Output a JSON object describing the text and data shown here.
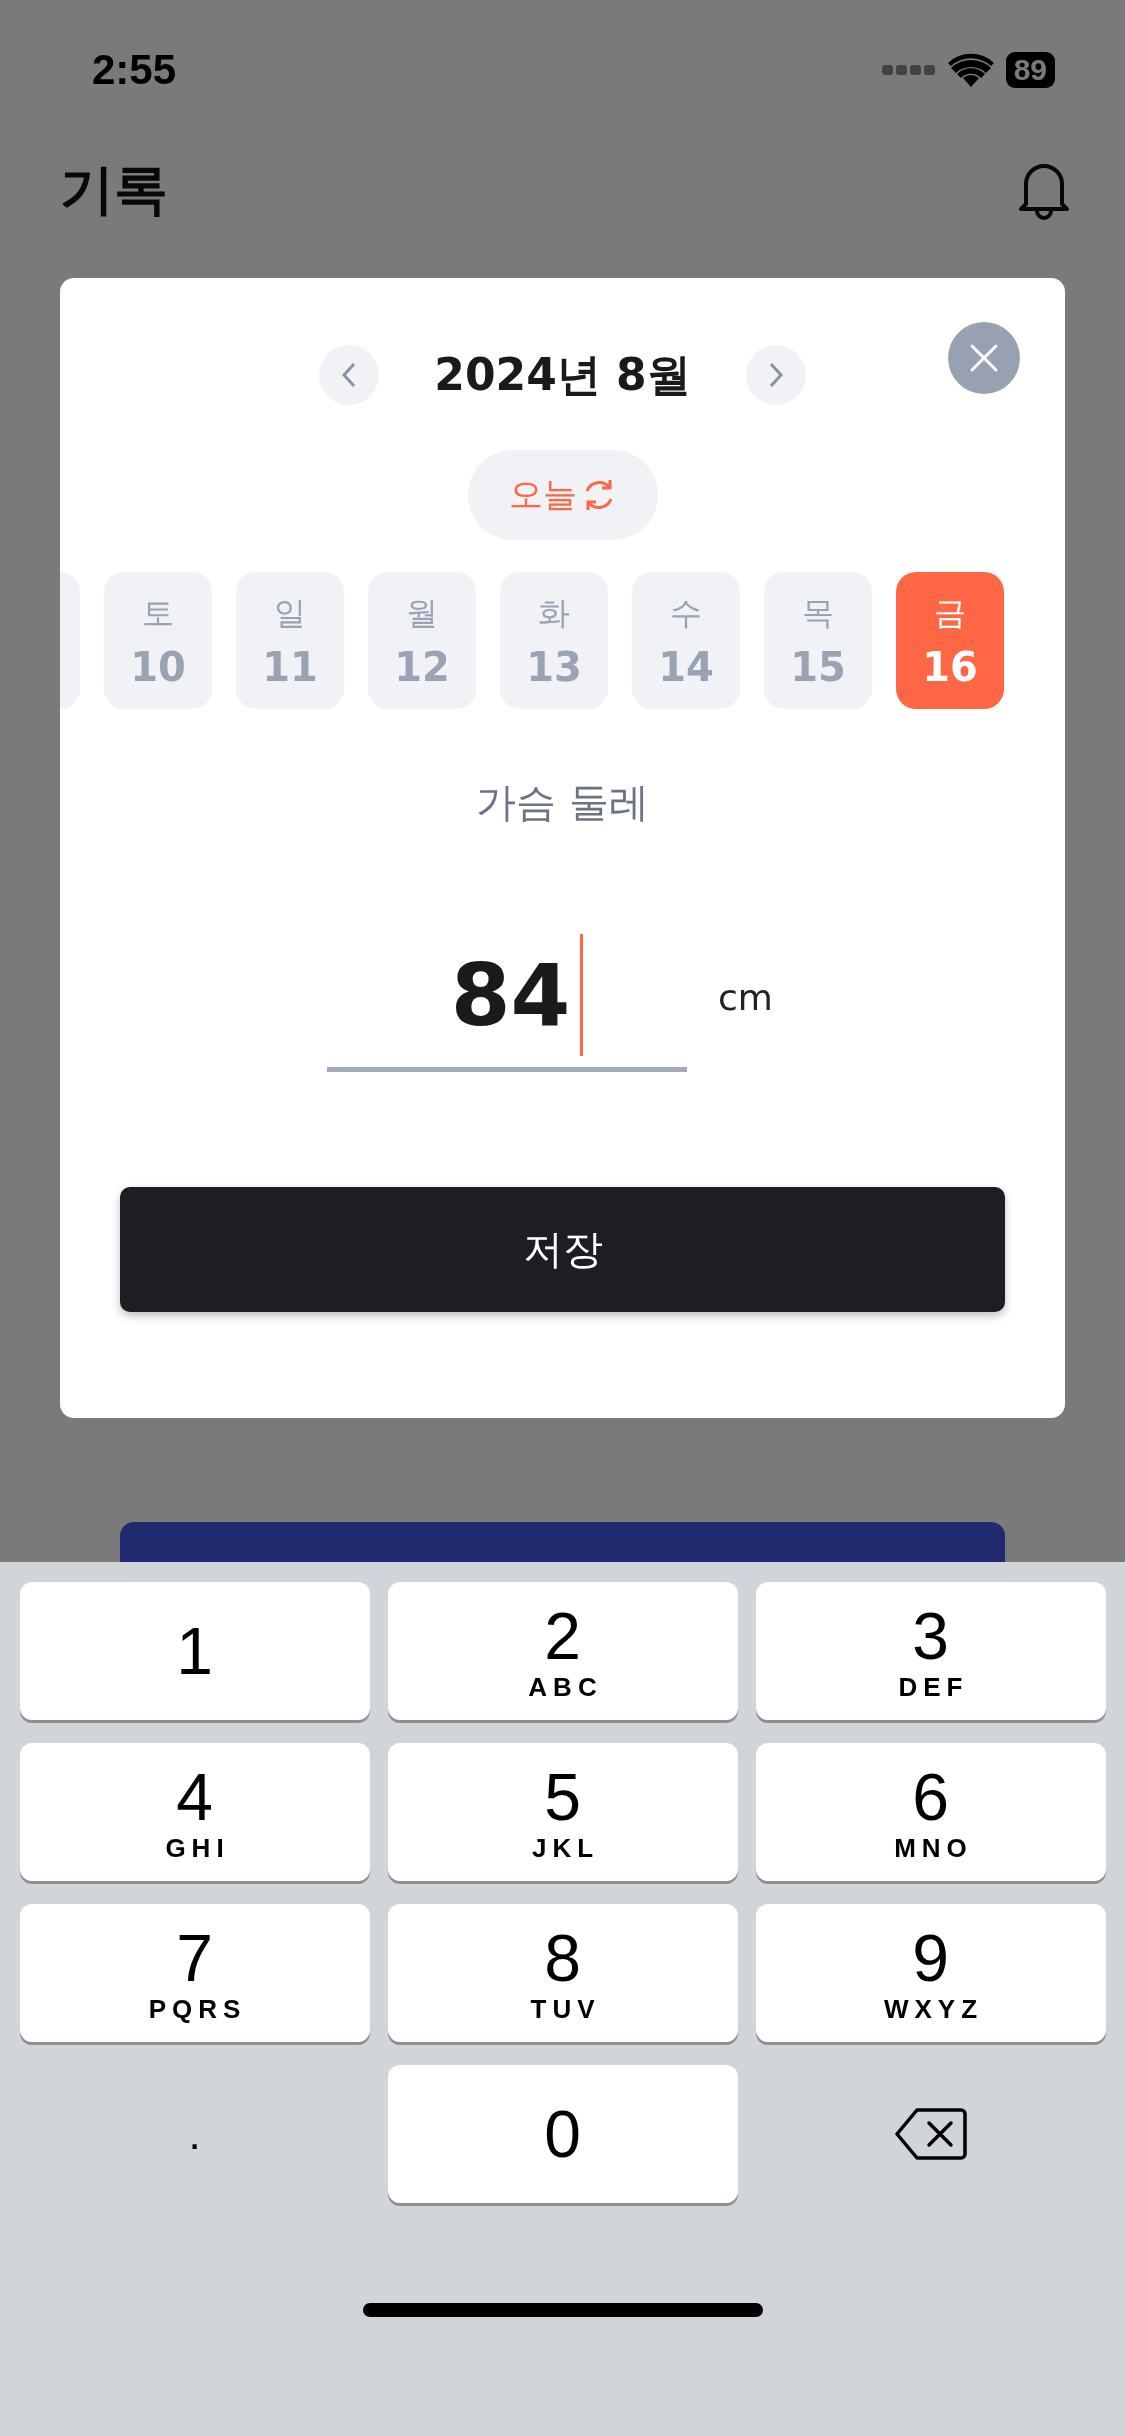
{
  "status_bar": {
    "time": "2:55",
    "battery": "89"
  },
  "header": {
    "title": "기록"
  },
  "modal": {
    "month": "2024년 8월",
    "today_button": "오늘",
    "field_label": "가슴 둘레",
    "value": "84",
    "unit": "cm",
    "save_button": "저장",
    "days": [
      {
        "weekday": "토",
        "date": "10",
        "selected": false
      },
      {
        "weekday": "일",
        "date": "11",
        "selected": false
      },
      {
        "weekday": "월",
        "date": "12",
        "selected": false
      },
      {
        "weekday": "화",
        "date": "13",
        "selected": false
      },
      {
        "weekday": "수",
        "date": "14",
        "selected": false
      },
      {
        "weekday": "목",
        "date": "15",
        "selected": false
      },
      {
        "weekday": "금",
        "date": "16",
        "selected": true
      }
    ]
  },
  "keypad": {
    "keys": [
      {
        "kind": "digit",
        "digit": "1"
      },
      {
        "kind": "digit",
        "digit": "2",
        "letters": "ABC"
      },
      {
        "kind": "digit",
        "digit": "3",
        "letters": "DEF"
      },
      {
        "kind": "digit",
        "digit": "4",
        "letters": "GHI"
      },
      {
        "kind": "digit",
        "digit": "5",
        "letters": "JKL"
      },
      {
        "kind": "digit",
        "digit": "6",
        "letters": "MNO"
      },
      {
        "kind": "digit",
        "digit": "7",
        "letters": "PQRS"
      },
      {
        "kind": "digit",
        "digit": "8",
        "letters": "TUV"
      },
      {
        "kind": "digit",
        "digit": "9",
        "letters": "WXYZ"
      },
      {
        "kind": "symbol",
        "digit": "."
      },
      {
        "kind": "digit",
        "digit": "0"
      },
      {
        "kind": "delete"
      }
    ]
  }
}
